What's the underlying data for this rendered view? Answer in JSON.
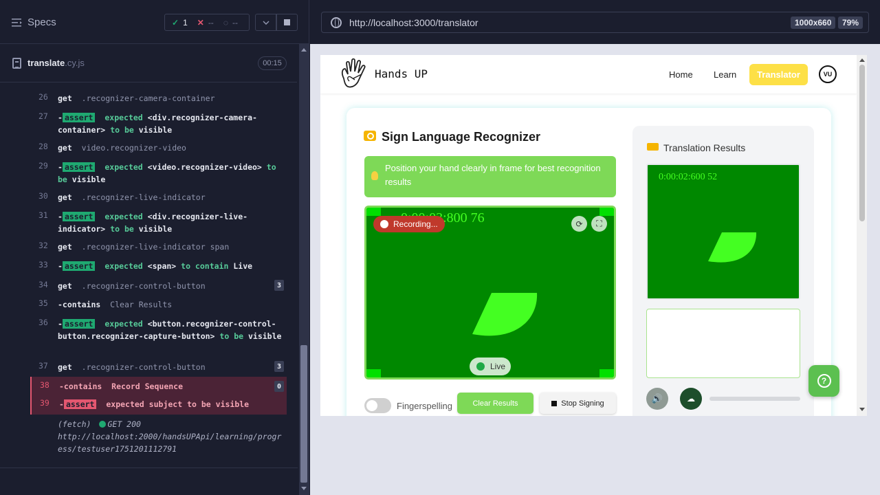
{
  "reporter": {
    "specs_label": "Specs",
    "stats": {
      "passed": "1",
      "failed": "--",
      "pending": "--"
    },
    "file": {
      "name": "translate",
      "ext": ".cy.js",
      "duration": "00:15"
    },
    "commands": [
      {
        "num": "26",
        "name": "get",
        "selector": ".recognizer-camera-container"
      },
      {
        "num": "27",
        "assert": "assert",
        "text1": "expected",
        "subject": "<div.recognizer-camera-container>",
        "text2": "to be",
        "value": "visible"
      },
      {
        "num": "28",
        "name": "get",
        "selector": "video.recognizer-video"
      },
      {
        "num": "29",
        "assert": "assert",
        "text1": "expected",
        "subject": "<video.recognizer-video>",
        "text2": "to be",
        "value": "visible"
      },
      {
        "num": "30",
        "name": "get",
        "selector": ".recognizer-live-indicator"
      },
      {
        "num": "31",
        "assert": "assert",
        "text1": "expected",
        "subject": "<div.recognizer-live-indicator>",
        "text2": "to be",
        "value": "visible"
      },
      {
        "num": "32",
        "name": "get",
        "selector": ".recognizer-live-indicator span"
      },
      {
        "num": "33",
        "assert": "assert",
        "text1": "expected",
        "subject": "<span>",
        "text2": "to contain",
        "value": "Live"
      },
      {
        "num": "34",
        "name": "get",
        "selector": ".recognizer-control-button",
        "badge": "3"
      },
      {
        "num": "35",
        "name": "-contains",
        "selector": "Clear Results"
      },
      {
        "num": "36",
        "assert": "assert",
        "text1": "expected",
        "subject": "<button.recognizer-control-button.recognizer-capture-button>",
        "text2": "to be",
        "value": "visible"
      },
      {
        "num": "37",
        "name": "get",
        "selector": ".recognizer-control-button",
        "badge": "3"
      },
      {
        "num": "38",
        "name": "-contains",
        "selector": "Record Sequence",
        "badge": "0"
      },
      {
        "num": "39",
        "assert": "assert",
        "text1": "expected",
        "subject": "subject",
        "text2": "to be",
        "value": "visible"
      }
    ],
    "fetch": {
      "label": "(fetch)",
      "method": "GET 200",
      "url": "http://localhost:2000/handsUPApi/learning/progress/testuser1751201112791"
    }
  },
  "browser": {
    "url": "http://localhost:3000/translator",
    "viewport": "1000x660",
    "zoom": "79%"
  },
  "app": {
    "brand": "Hands UP",
    "nav": {
      "home": "Home",
      "learn": "Learn",
      "translator": "Translator",
      "avatar": "VU"
    },
    "recognizer": {
      "title": "Sign Language Recognizer",
      "tip": "Position your hand clearly in frame for best recognition results",
      "camera_timestamp": "0:00:03:800 76",
      "recording_label": "Recording...",
      "live_label": "Live",
      "fingerspelling_label": "Fingerspelling",
      "fingerspelling_on": false,
      "clear_label": "Clear Results",
      "stop_label": "Stop Signing"
    },
    "results": {
      "title": "Translation Results",
      "timestamp": "0:00:02:600 52"
    }
  },
  "colors": {
    "accent_green": "#7ed957",
    "camera_bg": "#008800",
    "translator_yellow": "#fde047",
    "fail_red": "#e45770",
    "pass_green": "#1fa971"
  }
}
